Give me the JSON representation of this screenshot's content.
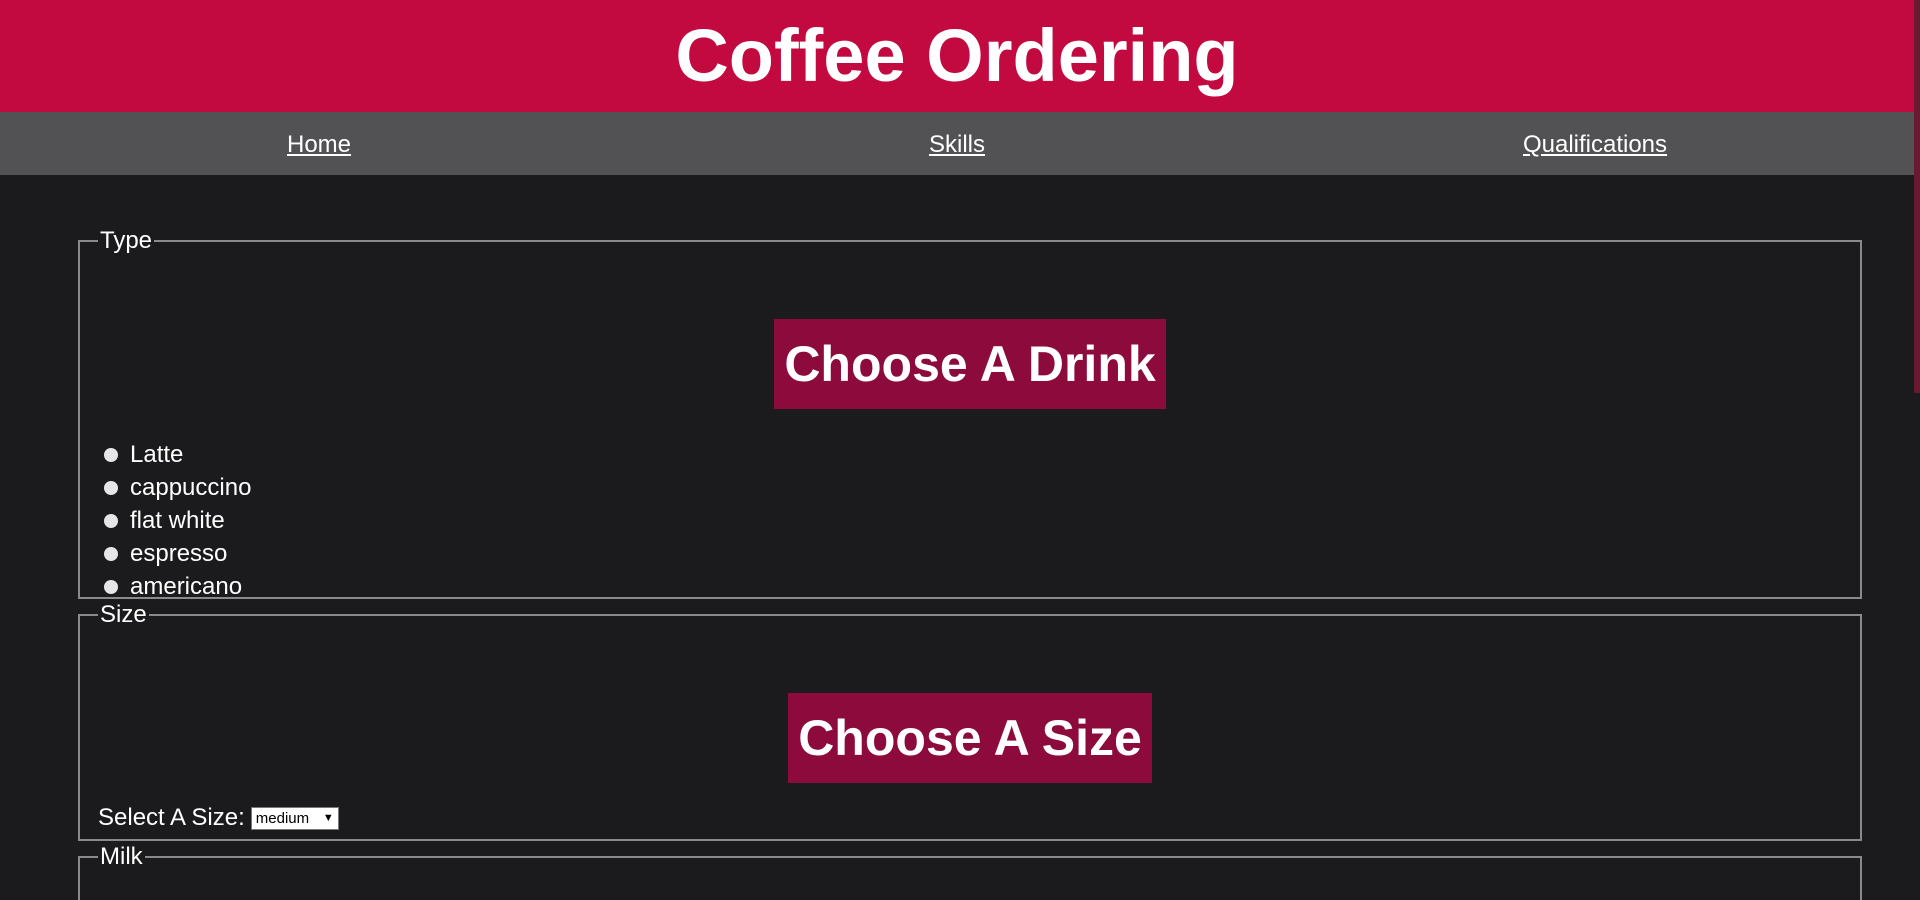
{
  "header": {
    "title": "Coffee Ordering"
  },
  "nav": {
    "items": [
      {
        "label": "Home"
      },
      {
        "label": "Skills"
      },
      {
        "label": "Qualifications"
      }
    ]
  },
  "type_section": {
    "legend": "Type",
    "heading": "Choose A Drink",
    "options": [
      "Latte",
      "cappuccino",
      "flat white",
      "espresso",
      "americano"
    ]
  },
  "size_section": {
    "legend": "Size",
    "heading": "Choose A Size",
    "select_label": "Select A Size:",
    "selected_value": "medium"
  },
  "milk_section": {
    "legend": "Milk"
  },
  "colors": {
    "header_bg": "#c20a41",
    "nav_bg": "#525254",
    "page_bg": "#1b1b1d",
    "heading_bg": "#8c0a3c"
  },
  "icons": {
    "select_caret": "chevron-down-icon"
  }
}
